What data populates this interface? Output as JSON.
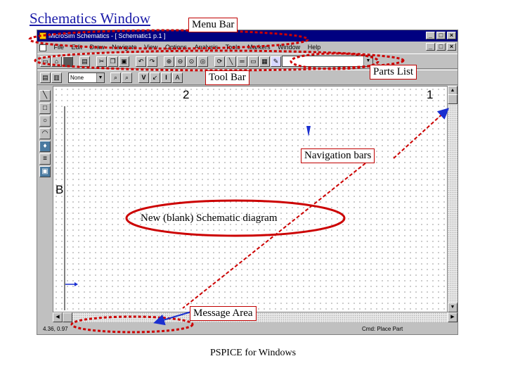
{
  "slide": {
    "title": "Schematics Window",
    "footer": "PSPICE for Windows"
  },
  "window": {
    "title": "MicroSim Schematics - [ Schematic1  p.1 ]",
    "menu": [
      "File",
      "Edit",
      "Draw",
      "Navigate",
      "View",
      "Options",
      "Analysis",
      "Tools",
      "Markers",
      "Window",
      "Help"
    ],
    "style_combo_value": "None",
    "status_coords": "4.36, 0.97",
    "status_command": "Cmd: Place Part"
  },
  "border_labels": {
    "top_left": "2",
    "top_right": "1",
    "left": "B"
  },
  "callouts": {
    "menu_bar": "Menu Bar",
    "tool_bar": "Tool Bar",
    "parts_list": "Parts List",
    "navigation_bars": "Navigation bars",
    "blank_schematic": "New (blank) Schematic diagram",
    "message_area": "Message Area"
  },
  "colors": {
    "callout_outline": "#cc0000",
    "title_bar": "#000080",
    "title_link": "#1a1aa8",
    "arrow": "#1a2fd0"
  }
}
